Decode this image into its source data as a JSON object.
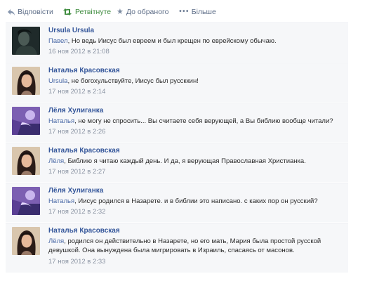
{
  "actions": {
    "reply": "Відповісти",
    "retweeted": "Ретвітнуте",
    "favorite": "До обраного",
    "more": "Більше"
  },
  "comments": [
    {
      "author": "Ursula Ursula",
      "addressee": "Павел",
      "text": ", Но ведь Иисус был евреем и был крещен по еврейскому обычаю.",
      "date": "16 ноя 2012 в 21:08",
      "avatar": "dark-portrait"
    },
    {
      "author": "Наталья Красовская",
      "addressee": "Ursula",
      "text": ", не богохульствуйте, Иисус был руссккин!",
      "date": "17 ноя 2012 в 2:14",
      "avatar": "woman-headscarf"
    },
    {
      "author": "Лёля Хулиганка",
      "addressee": "Наталья",
      "text": ", не могу не спросить... Вы считаете себя верующей, а Вы библию вообще читали?",
      "date": "17 ноя 2012 в 2:26",
      "avatar": "purple-fantasy"
    },
    {
      "author": "Наталья Красовская",
      "addressee": "Лёля",
      "text": ", Библию я читаю каждый день. И да, я верующая Православная Христианка.",
      "date": "17 ноя 2012 в 2:27",
      "avatar": "woman-headscarf"
    },
    {
      "author": "Лёля Хулиганка",
      "addressee": "Наталья",
      "text": ", Иисус родился в Назарете. и в библии это написано. с каких пор он русский?",
      "date": "17 ноя 2012 в 2:32",
      "avatar": "purple-fantasy"
    },
    {
      "author": "Наталья Красовская",
      "addressee": "Лёля",
      "text": ", родился он действительно в Назарете, но его мать, Мария была простой русской девушкой. Она вынуждена была мигрировать в Израиль, спасаясь от масонов.",
      "date": "17 ноя 2012 в 2:33",
      "avatar": "woman-headscarf"
    }
  ]
}
